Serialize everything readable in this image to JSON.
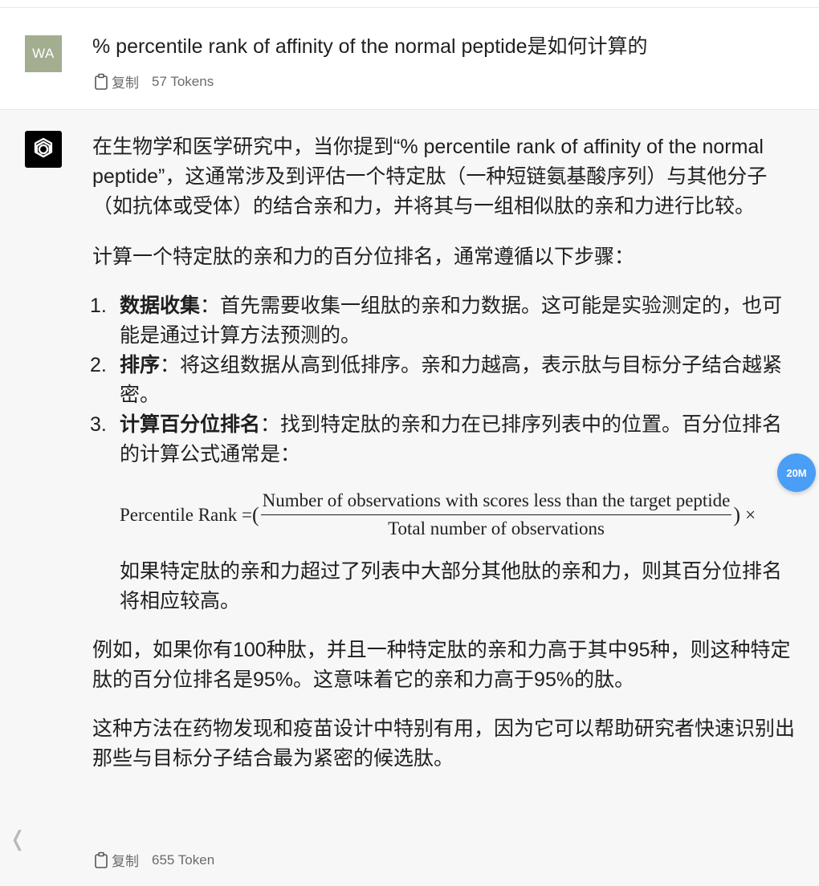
{
  "user_message": {
    "avatar": "WA",
    "text": "% percentile rank of affinity of the normal peptide是如何计算的",
    "copy_label": "复制",
    "tokens": "57 Tokens"
  },
  "assistant_message": {
    "para1": "在生物学和医学研究中，当你提到“% percentile rank of affinity of the normal peptide”，这通常涉及到评估一个特定肽（一种短链氨基酸序列）与其他分子（如抗体或受体）的结合亲和力，并将其与一组相似肽的亲和力进行比较。",
    "para2": "计算一个特定肽的亲和力的百分位排名，通常遵循以下步骤：",
    "steps": [
      {
        "num": "1.",
        "title": "数据收集",
        "text": "：首先需要收集一组肽的亲和力数据。这可能是实验测定的，也可能是通过计算方法预测的。"
      },
      {
        "num": "2.",
        "title": "排序",
        "text": "：将这组数据从高到低排序。亲和力越高，表示肽与目标分子结合越紧密。"
      },
      {
        "num": "3.",
        "title": "计算百分位排名",
        "text": "：找到特定肽的亲和力在已排序列表中的位置。百分位排名的计算公式通常是："
      }
    ],
    "formula": {
      "lhs": "Percentile Rank = ",
      "open": "(",
      "numerator": "Number of observations with scores less than the target peptide",
      "denominator": "Total number of observations",
      "close": ")",
      "times": "×"
    },
    "after_formula": "如果特定肽的亲和力超过了列表中大部分其他肽的亲和力，则其百分位排名将相应较高。",
    "para4": "例如，如果你有100种肽，并且一种特定肽的亲和力高于其中95种，则这种特定肽的百分位排名是95%。这意味着它的亲和力高于95%的肽。",
    "para5": "这种方法在药物发现和疫苗设计中特别有用，因为它可以帮助研究者快速识别出那些与目标分子结合最为紧密的候选肽。",
    "copy_label": "复制",
    "tokens": "655 Token"
  },
  "floating_badge": "20M",
  "side_arrow": "❬",
  "icons": {
    "copy": "clipboard-icon",
    "bot": "openai-logo-icon"
  },
  "colors": {
    "user_avatar_bg": "#a3ad8f",
    "bot_bg": "#f7f7f8",
    "badge_bg": "#4a9ef5"
  }
}
